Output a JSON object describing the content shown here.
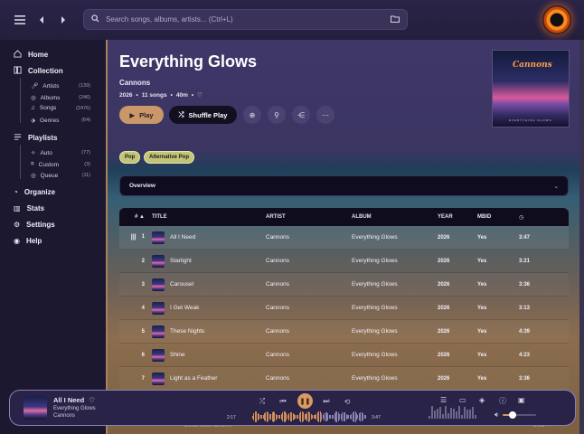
{
  "search": {
    "placeholder": "Search songs, albums, artists... (Ctrl+L)"
  },
  "sidebar": {
    "home": "Home",
    "collection": "Collection",
    "collection_items": [
      {
        "label": "Artists",
        "count": "(139)"
      },
      {
        "label": "Albums",
        "count": "(246)"
      },
      {
        "label": "Songs",
        "count": "(2476)"
      },
      {
        "label": "Genres",
        "count": "(64)"
      }
    ],
    "playlists": "Playlists",
    "playlist_items": [
      {
        "label": "Auto",
        "count": "(77)"
      },
      {
        "label": "Custom",
        "count": "(3)"
      },
      {
        "label": "Queue",
        "count": "(11)"
      }
    ],
    "organize": "Organize",
    "stats": "Stats",
    "settings": "Settings",
    "help": "Help"
  },
  "album": {
    "title": "Everything Glows",
    "artist": "Cannons",
    "year": "2026",
    "songs": "11 songs",
    "length": "40m",
    "play_label": "Play",
    "shuffle_label": "Shuffle Play",
    "cover_brand": "Cannons",
    "cover_subtitle": "EVERYTHING GLOWS"
  },
  "tags": [
    "Pop",
    "Alternative Pop"
  ],
  "overview_label": "Overview",
  "table": {
    "headers": {
      "num": "#",
      "title": "TITLE",
      "artist": "ARTIST",
      "album": "ALBUM",
      "year": "YEAR",
      "mbid": "MBID"
    },
    "rows": [
      {
        "num": "1",
        "title": "All I Need",
        "artist": "Cannons",
        "album": "Everything Glows",
        "year": "2026",
        "mbid": "Yes",
        "duration": "3:47"
      },
      {
        "num": "2",
        "title": "Starlight",
        "artist": "Cannons",
        "album": "Everything Glows",
        "year": "2026",
        "mbid": "Yes",
        "duration": "3:21"
      },
      {
        "num": "3",
        "title": "Carousel",
        "artist": "Cannons",
        "album": "Everything Glows",
        "year": "2026",
        "mbid": "Yes",
        "duration": "3:36"
      },
      {
        "num": "4",
        "title": "I Get Weak",
        "artist": "Cannons",
        "album": "Everything Glows",
        "year": "2026",
        "mbid": "Yes",
        "duration": "3:13"
      },
      {
        "num": "5",
        "title": "These Nights",
        "artist": "Cannons",
        "album": "Everything Glows",
        "year": "2026",
        "mbid": "Yes",
        "duration": "4:39"
      },
      {
        "num": "6",
        "title": "Shine",
        "artist": "Cannons",
        "album": "Everything Glows",
        "year": "2026",
        "mbid": "Yes",
        "duration": "4:23"
      },
      {
        "num": "7",
        "title": "Light as a Feather",
        "artist": "Cannons",
        "album": "Everything Glows",
        "year": "2026",
        "mbid": "Yes",
        "duration": "3:36"
      }
    ],
    "peek_row": {
      "num": "9",
      "title": "Good Luck Charm",
      "duration": "3:21"
    }
  },
  "player": {
    "title": "All I Need",
    "album": "Everything Glows",
    "artist": "Cannons",
    "elapsed": "2:17",
    "total": "3:47",
    "progress_fraction": 0.6,
    "volume_fraction": 0.3
  },
  "colors": {
    "accent": "#d89a62",
    "tag": "#c2c47a",
    "background": "#1b1830"
  }
}
